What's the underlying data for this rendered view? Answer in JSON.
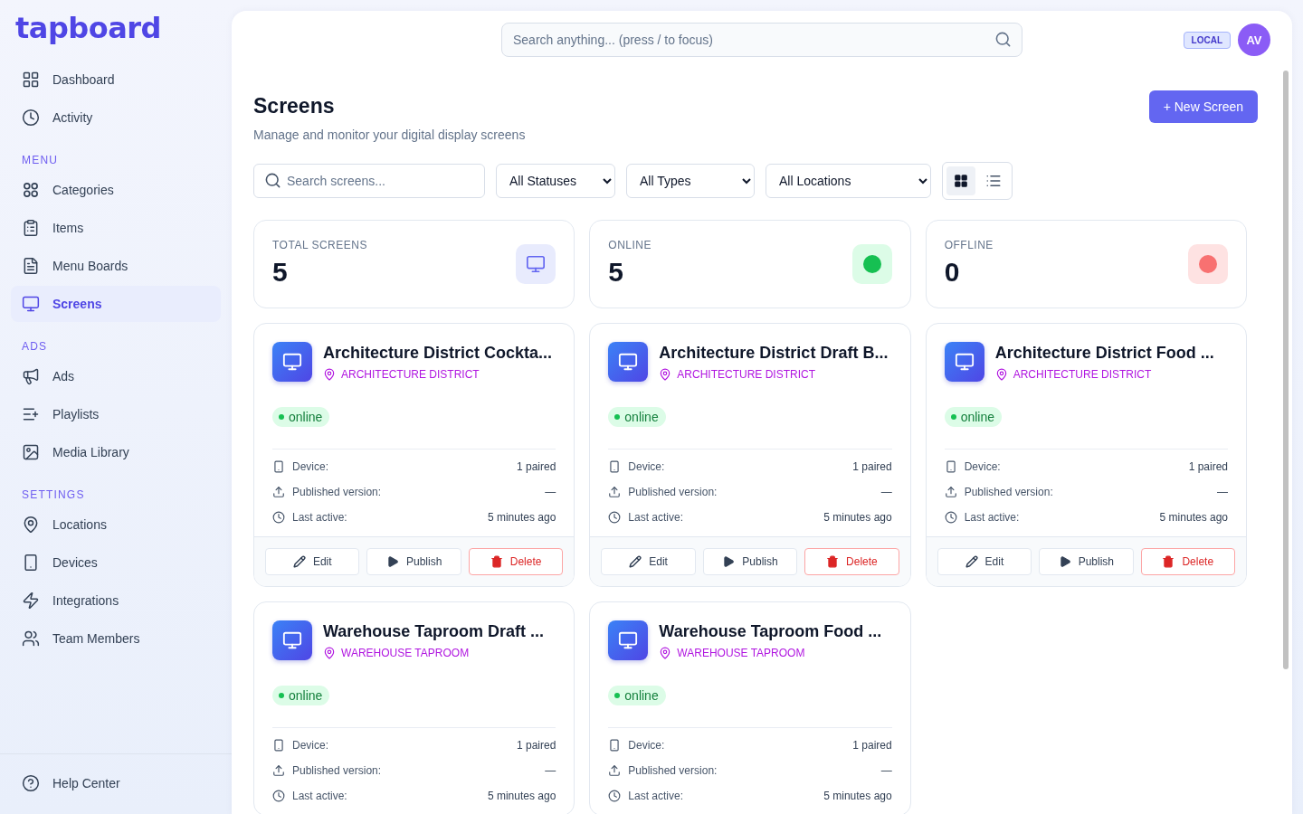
{
  "brand": {
    "name": "tapboard"
  },
  "sidebar": {
    "sections": [
      {
        "items": [
          {
            "label": "Dashboard",
            "kind": "dashboard",
            "selected": false
          },
          {
            "label": "Activity",
            "kind": "activity",
            "selected": false
          }
        ]
      },
      {
        "heading": "MENU",
        "items": [
          {
            "label": "Categories",
            "kind": "categories",
            "selected": false
          },
          {
            "label": "Items",
            "kind": "items",
            "selected": false
          },
          {
            "label": "Menu Boards",
            "kind": "boards",
            "selected": false
          },
          {
            "label": "Screens",
            "kind": "screens",
            "selected": true
          }
        ]
      },
      {
        "heading": "ADS",
        "items": [
          {
            "label": "Ads",
            "kind": "ads",
            "selected": false
          },
          {
            "label": "Playlists",
            "kind": "playlists",
            "selected": false
          },
          {
            "label": "Media Library",
            "kind": "media",
            "selected": false
          }
        ]
      },
      {
        "heading": "SETTINGS",
        "items": [
          {
            "label": "Locations",
            "kind": "locations",
            "selected": false
          },
          {
            "label": "Devices",
            "kind": "devices",
            "selected": false
          },
          {
            "label": "Integrations",
            "kind": "integrations",
            "selected": false
          },
          {
            "label": "Team Members",
            "kind": "team",
            "selected": false
          }
        ]
      }
    ],
    "footer": {
      "label": "Help Center",
      "kind": "help",
      "selected": false
    }
  },
  "topbar": {
    "search": {
      "placeholder": "Search anything... (press / to focus)"
    },
    "env_badge": "LOCAL",
    "avatar": "AV"
  },
  "page": {
    "title": "Screens",
    "subtitle": "Manage and monitor your digital display screens",
    "new_button": "+ New Screen"
  },
  "filters": {
    "search": {
      "placeholder": "Search screens..."
    },
    "selects": [
      "All Statuses",
      "All Types",
      "All Locations"
    ],
    "views": [
      {
        "kind": "grid",
        "selected": true
      },
      {
        "kind": "list",
        "selected": false
      }
    ]
  },
  "stats": [
    {
      "kind": "total",
      "label": "TOTAL SCREENS",
      "value": "5"
    },
    {
      "kind": "online",
      "label": "ONLINE",
      "value": "5"
    },
    {
      "kind": "offline",
      "label": "OFFLINE",
      "value": "0"
    }
  ],
  "screens": [
    {
      "title": "Architecture District Cockta...",
      "location": "ARCHITECTURE DISTRICT",
      "status": "online",
      "online": true,
      "details": [
        {
          "kind": "device",
          "label": "Device:",
          "value": "1 paired"
        },
        {
          "kind": "published",
          "label": "Published version:",
          "value": "—"
        },
        {
          "kind": "last_active",
          "label": "Last active:",
          "value": "5 minutes ago"
        }
      ],
      "actions": [
        {
          "kind": "edit",
          "label": "Edit"
        },
        {
          "kind": "publish",
          "label": "Publish"
        },
        {
          "kind": "delete",
          "label": "Delete"
        }
      ]
    },
    {
      "title": "Architecture District Draft B...",
      "location": "ARCHITECTURE DISTRICT",
      "status": "online",
      "online": true,
      "details": [
        {
          "kind": "device",
          "label": "Device:",
          "value": "1 paired"
        },
        {
          "kind": "published",
          "label": "Published version:",
          "value": "—"
        },
        {
          "kind": "last_active",
          "label": "Last active:",
          "value": "5 minutes ago"
        }
      ],
      "actions": [
        {
          "kind": "edit",
          "label": "Edit"
        },
        {
          "kind": "publish",
          "label": "Publish"
        },
        {
          "kind": "delete",
          "label": "Delete"
        }
      ]
    },
    {
      "title": "Architecture District Food ...",
      "location": "ARCHITECTURE DISTRICT",
      "status": "online",
      "online": true,
      "details": [
        {
          "kind": "device",
          "label": "Device:",
          "value": "1 paired"
        },
        {
          "kind": "published",
          "label": "Published version:",
          "value": "—"
        },
        {
          "kind": "last_active",
          "label": "Last active:",
          "value": "5 minutes ago"
        }
      ],
      "actions": [
        {
          "kind": "edit",
          "label": "Edit"
        },
        {
          "kind": "publish",
          "label": "Publish"
        },
        {
          "kind": "delete",
          "label": "Delete"
        }
      ]
    },
    {
      "title": "Warehouse Taproom Draft ...",
      "location": "WAREHOUSE TAPROOM",
      "status": "online",
      "online": true,
      "details": [
        {
          "kind": "device",
          "label": "Device:",
          "value": "1 paired"
        },
        {
          "kind": "published",
          "label": "Published version:",
          "value": "—"
        },
        {
          "kind": "last_active",
          "label": "Last active:",
          "value": "5 minutes ago"
        }
      ]
    },
    {
      "title": "Warehouse Taproom Food ...",
      "location": "WAREHOUSE TAPROOM",
      "status": "online",
      "online": true,
      "details": [
        {
          "kind": "device",
          "label": "Device:",
          "value": "1 paired"
        },
        {
          "kind": "published",
          "label": "Published version:",
          "value": "—"
        },
        {
          "kind": "last_active",
          "label": "Last active:",
          "value": "5 minutes ago"
        }
      ]
    }
  ]
}
